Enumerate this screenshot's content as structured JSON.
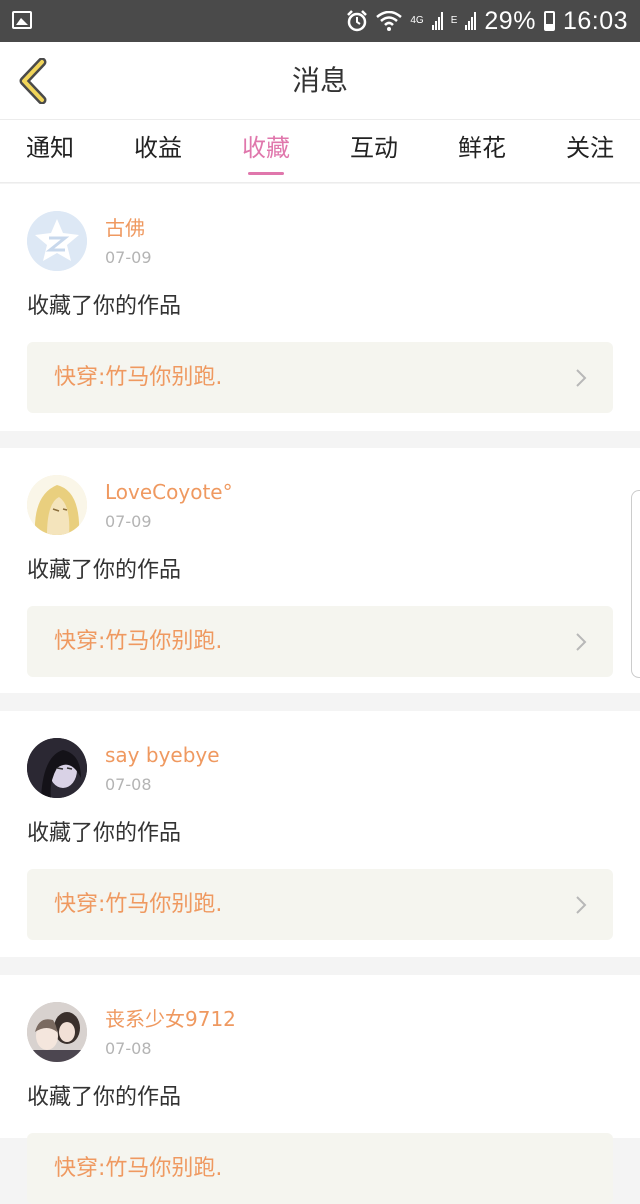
{
  "status_bar": {
    "battery": "29%",
    "time": "16:03",
    "network_1": "4G",
    "network_2": "E",
    "icons": [
      "gallery-icon",
      "alarm-icon",
      "wifi-icon",
      "signal-icon",
      "battery-icon"
    ]
  },
  "header": {
    "title": "消息",
    "back_icon": "chevron-left-icon"
  },
  "tabs": [
    {
      "label": "通知",
      "active": false
    },
    {
      "label": "收益",
      "active": false
    },
    {
      "label": "收藏",
      "active": true
    },
    {
      "label": "互动",
      "active": false
    },
    {
      "label": "鲜花",
      "active": false
    },
    {
      "label": "关注",
      "active": false
    }
  ],
  "messages": [
    {
      "user": "古佛",
      "date": "07-09",
      "action": "收藏了你的作品",
      "work_title": "快穿:竹马你别跑.",
      "avatar": "qzone-default-avatar"
    },
    {
      "user": "LoveCoyote°",
      "date": "07-09",
      "action": "收藏了你的作品",
      "work_title": "快穿:竹马你别跑.",
      "avatar": "anime-character-avatar"
    },
    {
      "user": "say byebye",
      "date": "07-08",
      "action": "收藏了你的作品",
      "work_title": "快穿:竹马你别跑.",
      "avatar": "dark-portrait-avatar"
    },
    {
      "user": "丧系少女9712",
      "date": "07-08",
      "action": "收藏了你的作品",
      "work_title": "快穿:竹马你别跑.",
      "avatar": "photo-avatar"
    }
  ],
  "colors": {
    "accent": "#e077ac",
    "username": "#ef9960",
    "status_bar": "#4a4a4a"
  }
}
